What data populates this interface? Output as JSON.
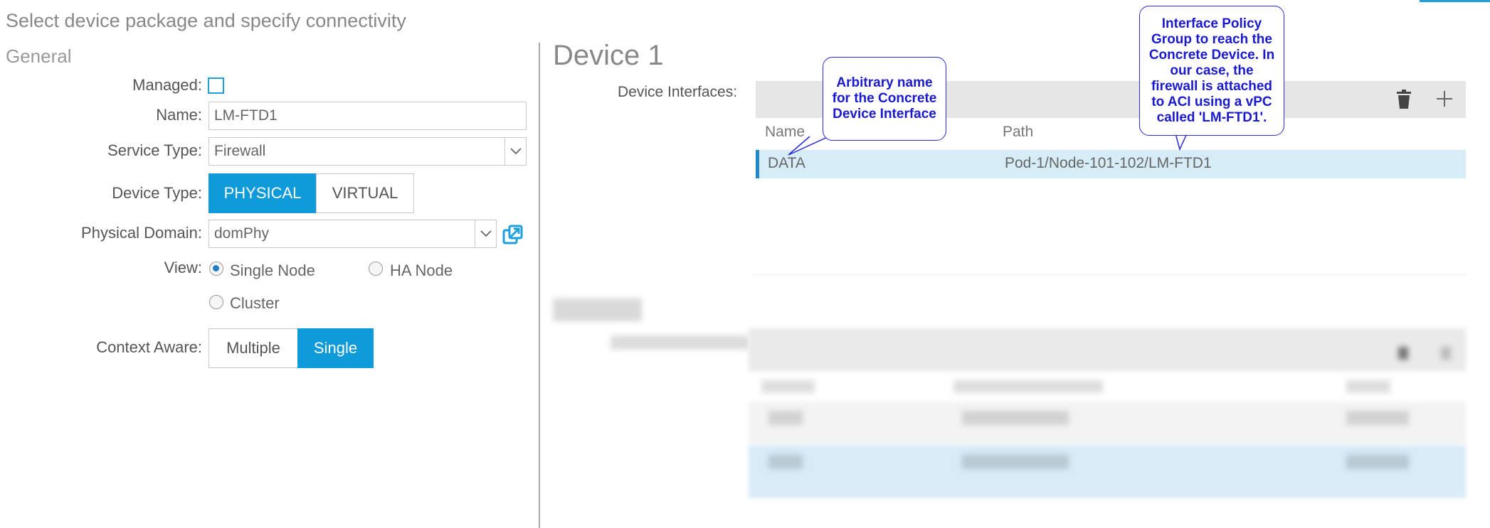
{
  "page_title": "Select device package and specify connectivity",
  "general": {
    "section_title": "General",
    "managed_label": "Managed:",
    "name_label": "Name:",
    "name_value": "LM-FTD1",
    "service_type_label": "Service Type:",
    "service_type_value": "Firewall",
    "device_type_label": "Device Type:",
    "device_type_options": [
      "PHYSICAL",
      "VIRTUAL"
    ],
    "physical_domain_label": "Physical Domain:",
    "physical_domain_value": "domPhy",
    "view_label": "View:",
    "view_options": [
      "Single Node",
      "HA Node",
      "Cluster"
    ],
    "context_aware_label": "Context Aware:",
    "context_aware_options": [
      "Multiple",
      "Single"
    ]
  },
  "device": {
    "title": "Device 1",
    "interfaces_label": "Device Interfaces:",
    "columns": [
      "Name",
      "Path"
    ],
    "rows": [
      {
        "name": "DATA",
        "path": "Pod-1/Node-101-102/LM-FTD1"
      }
    ]
  },
  "callouts": {
    "name_note": [
      "Arbitrary name",
      "for the Concrete",
      "Device Interface"
    ],
    "path_note": [
      "Interface Policy",
      "Group to reach the",
      "Concrete Device. In",
      "our case, the",
      "firewall is attached",
      "to ACI using a vPC",
      "called 'LM-FTD1'."
    ]
  },
  "colors": {
    "accent": "#0f9ad9",
    "selected_row": "#d6ecf7",
    "callout": "#1a1acc"
  }
}
